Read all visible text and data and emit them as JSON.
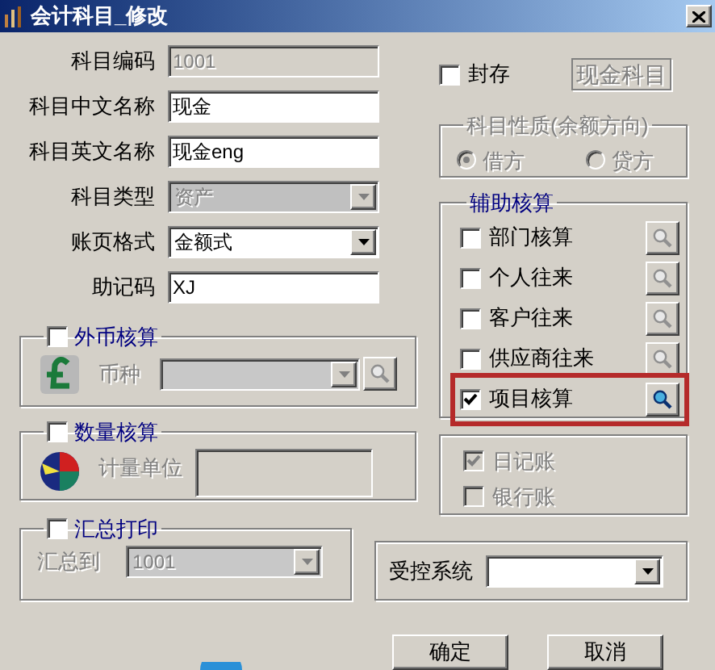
{
  "window": {
    "title": "会计科目_修改"
  },
  "fields": [
    {
      "label": "科目编码",
      "kind": "text",
      "value": "1001",
      "disabled": true
    },
    {
      "label": "科目中文名称",
      "kind": "text",
      "value": "现金",
      "disabled": false
    },
    {
      "label": "科目英文名称",
      "kind": "text",
      "value": "现金eng",
      "disabled": false
    },
    {
      "label": "科目类型",
      "kind": "dropdown",
      "value": "资产",
      "disabled": true
    },
    {
      "label": "账页格式",
      "kind": "dropdown",
      "value": "金额式",
      "disabled": false
    },
    {
      "label": "助记码",
      "kind": "text",
      "value": "XJ",
      "disabled": false
    }
  ],
  "foreign_currency": {
    "label": "外币核算",
    "checked": false,
    "field_label": "币种"
  },
  "quantity": {
    "label": "数量核算",
    "checked": false,
    "field_label": "计量单位"
  },
  "summary_print": {
    "label": "汇总打印",
    "checked": false,
    "field_label": "汇总到",
    "value": "1001"
  },
  "sealed": {
    "label": "封存",
    "checked": false
  },
  "category_field": {
    "value": "现金科目"
  },
  "balance_direction": {
    "title": "科目性质(余额方向)",
    "disabled": true,
    "options": [
      {
        "label": "借方",
        "selected": true
      },
      {
        "label": "贷方",
        "selected": false
      }
    ]
  },
  "auxiliary": {
    "title": "辅助核算",
    "items": [
      {
        "label": "部门核算",
        "checked": false,
        "highlighted": false
      },
      {
        "label": "个人往来",
        "checked": false,
        "highlighted": false
      },
      {
        "label": "客户往来",
        "checked": false,
        "highlighted": false
      },
      {
        "label": "供应商往来",
        "checked": false,
        "highlighted": false
      },
      {
        "label": "项目核算",
        "checked": true,
        "highlighted": true
      }
    ]
  },
  "books": {
    "disabled": true,
    "items": [
      {
        "label": "日记账",
        "checked": true
      },
      {
        "label": "银行账",
        "checked": false
      }
    ]
  },
  "controlled_system": {
    "label": "受控系统"
  },
  "buttons": [
    "确定",
    "取消"
  ]
}
